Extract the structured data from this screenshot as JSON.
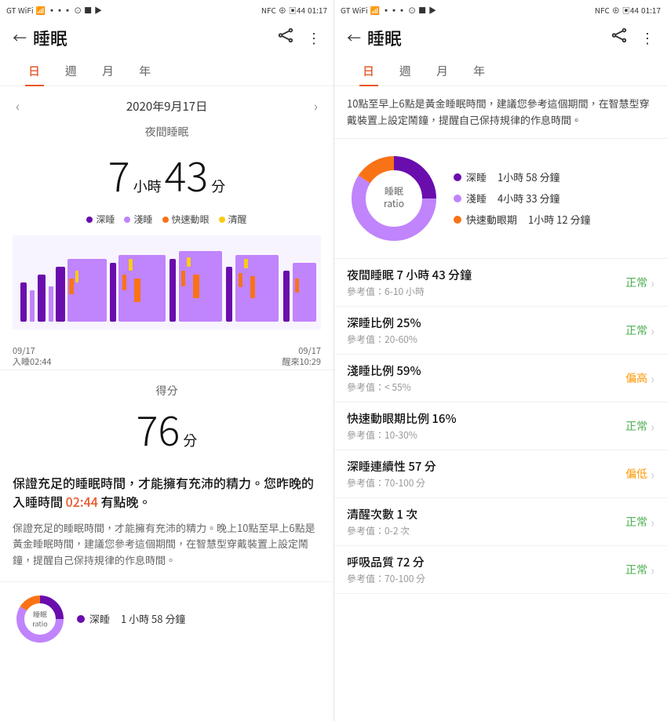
{
  "left_panel": {
    "status_bar": {
      "left": "GT WiFi WIFI ▪▪▪ ᵢ₁ ⊙ ■ ▶",
      "right": "NFC ⊕ ○ 44 01:17"
    },
    "header": {
      "back_icon": "←",
      "title": "睡眠",
      "route_icon": "⌒",
      "menu_icon": "⋮"
    },
    "tabs": [
      {
        "label": "日",
        "active": true
      },
      {
        "label": "週",
        "active": false
      },
      {
        "label": "月",
        "active": false
      },
      {
        "label": "年",
        "active": false
      }
    ],
    "date": "2020年9月17日",
    "sleep_type": "夜間睡眠",
    "sleep_duration": {
      "hours": "7",
      "hours_unit": "小時",
      "minutes": "43",
      "minutes_unit": "分"
    },
    "legend": [
      {
        "label": "深睡",
        "color": "#6a0dad"
      },
      {
        "label": "淺睡",
        "color": "#c084fc"
      },
      {
        "label": "快速動眼",
        "color": "#f97316"
      },
      {
        "label": "清醒",
        "color": "#facc15"
      }
    ],
    "time_labels": {
      "start": "09/17\n入睡02:44",
      "end": "09/17\n醒來10:29"
    },
    "score_section": {
      "label": "得分",
      "value": "76",
      "unit": "分"
    },
    "advice_highlight": "保證充足的睡眠時間，才能擁有充沛的精力。您昨晚的入睡時間 02:44 有點晚。",
    "advice_text": "保證充足的睡眠時間，才能擁有充沛的精力。晚上10點至早上6點是黃金睡眠時間，建議您參考這個期間，在智慧型穿戴裝置上設定鬧鐘，提醒自己保持規律的作息時間。",
    "bottom_donut": {
      "label": "睡眠\nratio"
    },
    "bottom_stat": {
      "dot_color": "#6a0dad",
      "label": "深睡",
      "value": "1小時58分鐘"
    }
  },
  "right_panel": {
    "status_bar": {
      "left": "GT WiFi WIFI ▪▪▪ ᵢ₁ ⊙ ■ ▶",
      "right": "NFC ⊕ ○ 44 01:17"
    },
    "header": {
      "back_icon": "←",
      "title": "睡眠",
      "route_icon": "⌒",
      "menu_icon": "⋮"
    },
    "tabs": [
      {
        "label": "日",
        "active": true
      },
      {
        "label": "週",
        "active": false
      },
      {
        "label": "月",
        "active": false
      },
      {
        "label": "年",
        "active": false
      }
    ],
    "info_banner": "10點至早上6點是黃金睡眠時間，建議您參考這個期間，在智慧型穿戴裝置上設定鬧鐘，提醒自己保持規律的作息時間。",
    "donut_label_line1": "睡眠",
    "donut_label_line2": "ratio",
    "stats": [
      {
        "label": "深睡",
        "color": "#6a0dad",
        "value": "1小時 58 分鐘"
      },
      {
        "label": "淺睡",
        "color": "#c084fc",
        "value": "4小時 33 分鐘"
      },
      {
        "label": "快速動眼期",
        "color": "#f97316",
        "value": "1小時 12 分鐘"
      }
    ],
    "donut_segments": [
      {
        "label": "深睡",
        "color": "#6a0dad",
        "percent": 25
      },
      {
        "label": "淺睡",
        "color": "#c084fc",
        "percent": 59
      },
      {
        "label": "快速動眼",
        "color": "#f97316",
        "percent": 16
      }
    ],
    "metrics": [
      {
        "title": "夜間睡眠  7 小時 43 分鐘",
        "ref": "參考值：6-10 小時",
        "status": "正常",
        "status_type": "normal"
      },
      {
        "title": "深睡比例  25%",
        "ref": "參考值：20-60%",
        "status": "正常",
        "status_type": "normal"
      },
      {
        "title": "淺睡比例  59%",
        "ref": "參考值：< 55%",
        "status": "偏高",
        "status_type": "high"
      },
      {
        "title": "快速動眼期比例  16%",
        "ref": "參考值：10-30%",
        "status": "正常",
        "status_type": "normal"
      },
      {
        "title": "深睡連續性  57 分",
        "ref": "參考值：70-100 分",
        "status": "偏低",
        "status_type": "low"
      },
      {
        "title": "清醒次數  1 次",
        "ref": "參考值：0-2 次",
        "status": "正常",
        "status_type": "normal"
      },
      {
        "title": "呼吸品質  72 分",
        "ref": "參考值：70-100 分",
        "status": "正常",
        "status_type": "normal"
      }
    ]
  }
}
